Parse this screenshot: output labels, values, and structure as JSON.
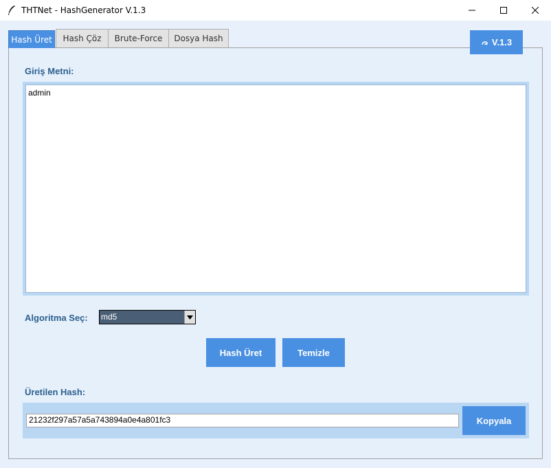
{
  "window": {
    "title": "THTNet - HashGenerator V.1.3",
    "icons": {
      "app": "feather-icon",
      "minimize": "minimize-icon",
      "maximize": "maximize-icon",
      "close": "close-icon"
    }
  },
  "tabs": [
    {
      "label": "Hash Üret",
      "active": true
    },
    {
      "label": "Hash Çöz",
      "active": false
    },
    {
      "label": "Brute-Force",
      "active": false
    },
    {
      "label": "Dosya Hash",
      "active": false
    }
  ],
  "version_badge": {
    "icon": "swirl-icon",
    "label": "V.1.3"
  },
  "input": {
    "label": "Giriş Metni:",
    "value": "admin"
  },
  "algorithm": {
    "label": "Algoritma Seç:",
    "selected": "md5"
  },
  "buttons": {
    "generate": "Hash Üret",
    "clear": "Temizle",
    "copy": "Kopyala"
  },
  "output": {
    "label": "Üretilen Hash:",
    "value": "21232f297a57a5a743894a0e4a801fc3"
  },
  "colors": {
    "accent": "#4a90e2",
    "label_text": "#2c5f8f",
    "panel_bg": "#e6f0fb",
    "frame_bg": "#b9d6f3"
  }
}
